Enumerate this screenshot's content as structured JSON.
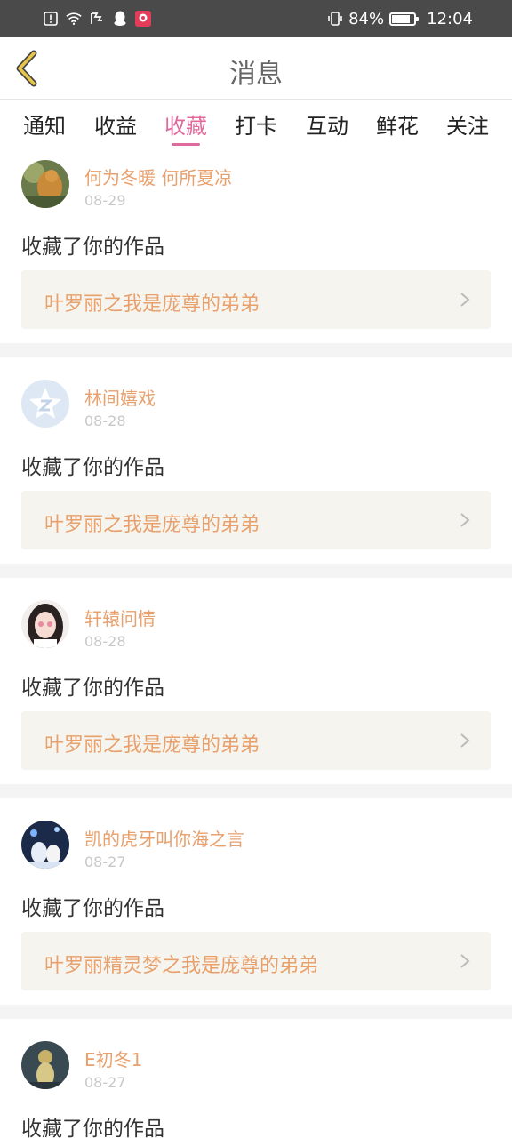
{
  "status_bar": {
    "battery_percent_label": "84%",
    "battery_level": 0.84,
    "time": "12:04"
  },
  "header": {
    "title": "消息"
  },
  "tabs": [
    {
      "label": "通知",
      "active": false
    },
    {
      "label": "收益",
      "active": false
    },
    {
      "label": "收藏",
      "active": true
    },
    {
      "label": "打卡",
      "active": false
    },
    {
      "label": "互动",
      "active": false
    },
    {
      "label": "鲜花",
      "active": false
    },
    {
      "label": "关注",
      "active": false
    }
  ],
  "items": [
    {
      "user": "何为冬暖 何所夏凉",
      "date": "08-29",
      "action": "收藏了你的作品",
      "work": "叶罗丽之我是庞尊的弟弟"
    },
    {
      "user": "林间嬉戏",
      "date": "08-28",
      "action": "收藏了你的作品",
      "work": "叶罗丽之我是庞尊的弟弟"
    },
    {
      "user": "轩辕问情",
      "date": "08-28",
      "action": "收藏了你的作品",
      "work": "叶罗丽之我是庞尊的弟弟"
    },
    {
      "user": "凯的虎牙叫你海之言",
      "date": "08-27",
      "action": "收藏了你的作品",
      "work": "叶罗丽精灵梦之我是庞尊的弟弟"
    },
    {
      "user": "E初冬1",
      "date": "08-27",
      "action": "收藏了你的作品",
      "work": ""
    }
  ],
  "colors": {
    "accent_pink": "#e06a9b",
    "name_orange": "#e8a06c",
    "back_arrow": "#e9c64a"
  }
}
